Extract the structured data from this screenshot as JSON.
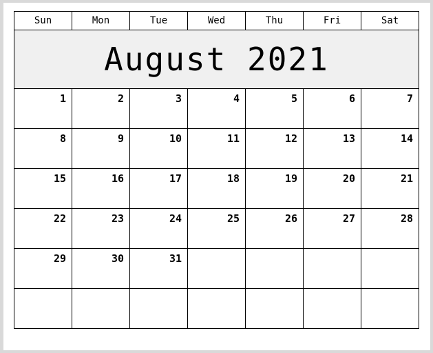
{
  "calendar": {
    "title": "August 2021",
    "month_name": "August",
    "year": "2021",
    "title_band_color": "#f0f0f0",
    "border_color": "#000000",
    "text_color": "#000000",
    "page_background": "#ffffff",
    "weekday_headers": [
      {
        "label": "Sun"
      },
      {
        "label": "Mon"
      },
      {
        "label": "Tue"
      },
      {
        "label": "Wed"
      },
      {
        "label": "Thu"
      },
      {
        "label": "Fri"
      },
      {
        "label": "Sat"
      }
    ],
    "weeks": [
      {
        "days": [
          {
            "number": "1"
          },
          {
            "number": "2"
          },
          {
            "number": "3"
          },
          {
            "number": "4"
          },
          {
            "number": "5"
          },
          {
            "number": "6"
          },
          {
            "number": "7"
          }
        ]
      },
      {
        "days": [
          {
            "number": "8"
          },
          {
            "number": "9"
          },
          {
            "number": "10"
          },
          {
            "number": "11"
          },
          {
            "number": "12"
          },
          {
            "number": "13"
          },
          {
            "number": "14"
          }
        ]
      },
      {
        "days": [
          {
            "number": "15"
          },
          {
            "number": "16"
          },
          {
            "number": "17"
          },
          {
            "number": "18"
          },
          {
            "number": "19"
          },
          {
            "number": "20"
          },
          {
            "number": "21"
          }
        ]
      },
      {
        "days": [
          {
            "number": "22"
          },
          {
            "number": "23"
          },
          {
            "number": "24"
          },
          {
            "number": "25"
          },
          {
            "number": "26"
          },
          {
            "number": "27"
          },
          {
            "number": "28"
          }
        ]
      },
      {
        "days": [
          {
            "number": "29"
          },
          {
            "number": "30"
          },
          {
            "number": "31"
          },
          {
            "number": ""
          },
          {
            "number": ""
          },
          {
            "number": ""
          },
          {
            "number": ""
          }
        ]
      },
      {
        "days": [
          {
            "number": ""
          },
          {
            "number": ""
          },
          {
            "number": ""
          },
          {
            "number": ""
          },
          {
            "number": ""
          },
          {
            "number": ""
          },
          {
            "number": ""
          }
        ]
      }
    ]
  }
}
